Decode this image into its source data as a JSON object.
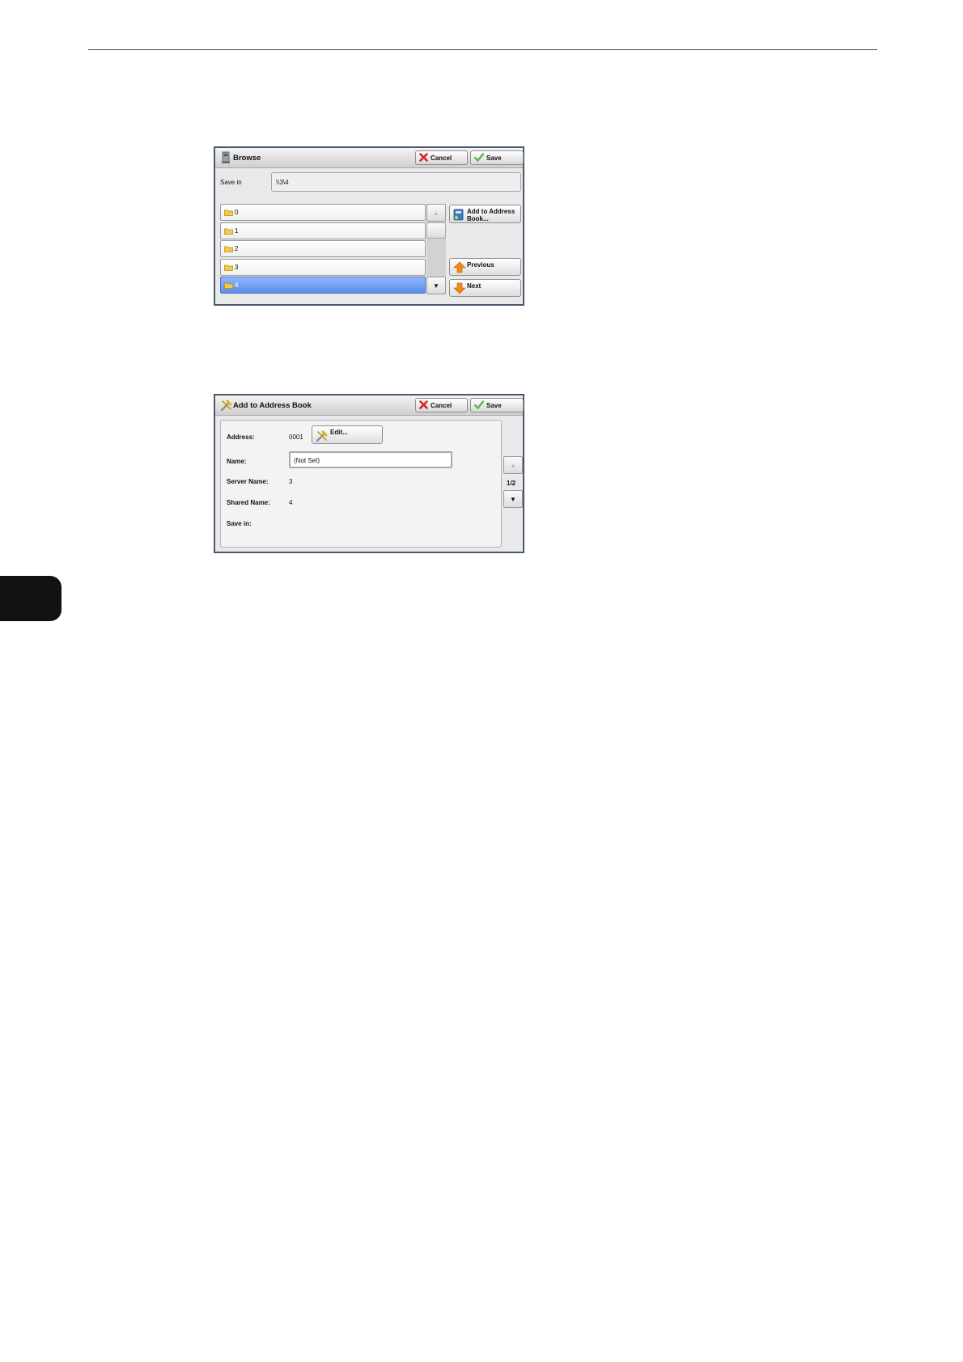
{
  "browse": {
    "title": "Browse",
    "cancel_label": "Cancel",
    "save_label": "Save",
    "save_in_label": "Save in",
    "save_in_value": "\\\\3\\4",
    "folders": [
      {
        "label": "0",
        "selected": false
      },
      {
        "label": "1",
        "selected": false
      },
      {
        "label": "2",
        "selected": false
      },
      {
        "label": "3",
        "selected": false
      },
      {
        "label": "4",
        "selected": true
      }
    ],
    "add_to_address_book_label_line1": "Add to Address",
    "add_to_address_book_label_line2": "Book...",
    "previous_label": "Previous",
    "next_label": "Next",
    "scroll_up_glyph": "▲",
    "scroll_down_glyph": "▼"
  },
  "address_book": {
    "title": "Add to Address Book",
    "cancel_label": "Cancel",
    "save_label": "Save",
    "address_label": "Address:",
    "address_value": "0001",
    "edit_label": "Edit...",
    "name_label": "Name:",
    "name_value": "(Not Set)",
    "server_name_label": "Server Name:",
    "server_name_value": "3",
    "shared_name_label": "Shared Name:",
    "shared_name_value": "4",
    "save_in_label": "Save in:",
    "save_in_value": "",
    "page_indicator": "1/2",
    "scroll_up_glyph": "▲",
    "scroll_down_glyph": "▼"
  },
  "colors": {
    "selected_row": "#5b8ee8",
    "panel_border": "#47596c",
    "cancel_icon": "#d9231c",
    "save_icon": "#58b848",
    "arrow_icon": "#f08a14"
  }
}
